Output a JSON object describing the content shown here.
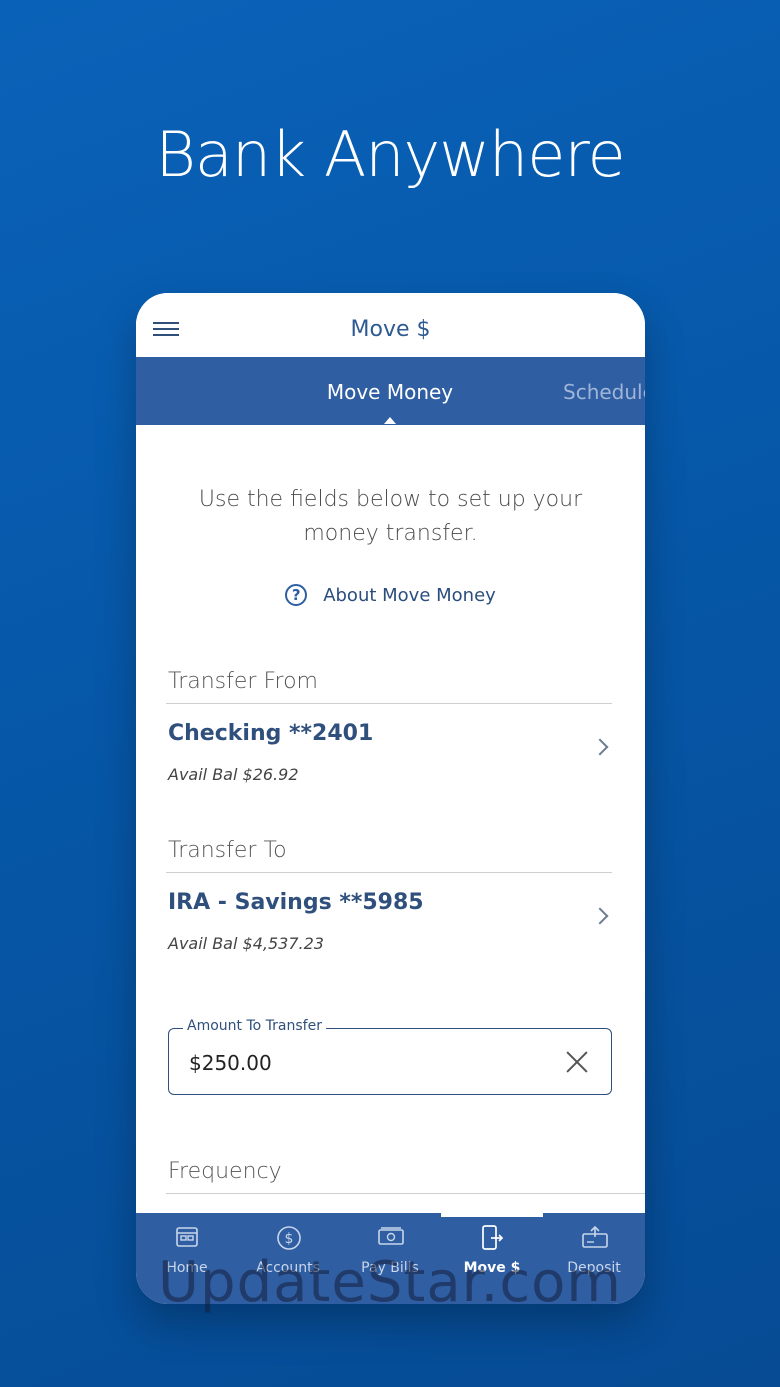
{
  "headline": "Bank Anywhere",
  "topbar": {
    "title": "Move $"
  },
  "tabs": {
    "active": "Move Money",
    "inactive": "Schedule"
  },
  "intro": "Use the fields below to set up your money transfer.",
  "about_link": "About Move Money",
  "transfer_from": {
    "label": "Transfer From",
    "account": "Checking **2401",
    "balance": "Avail Bal $26.92"
  },
  "transfer_to": {
    "label": "Transfer To",
    "account": "IRA - Savings **5985",
    "balance": "Avail Bal $4,537.23"
  },
  "amount": {
    "legend": "Amount To Transfer",
    "value": "$250.00"
  },
  "frequency": {
    "label": "Frequency"
  },
  "nav": {
    "home": "Home",
    "accounts": "Accounts",
    "pay_bills": "Pay Bills",
    "move": "Move $",
    "deposit": "Deposit"
  },
  "watermark": "UpdateStar.com",
  "colors": {
    "brand_blue": "#2f5ea3",
    "background": "#0657a8",
    "text_dark_blue": "#2f4f7c"
  }
}
